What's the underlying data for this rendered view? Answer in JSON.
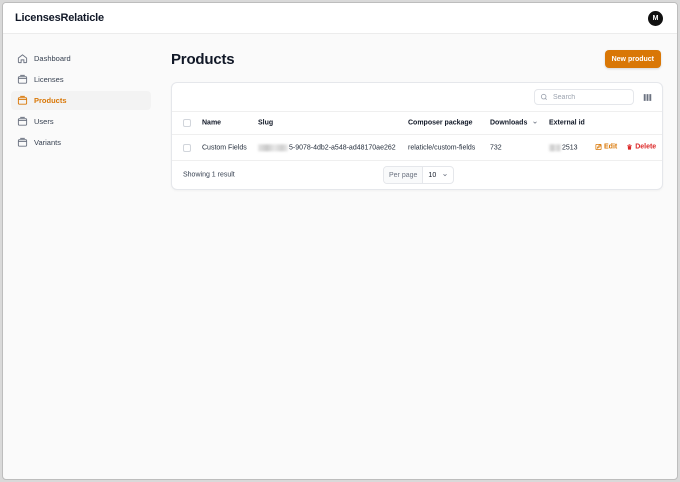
{
  "app": {
    "brand": "LicensesRelaticle",
    "avatar_initial": "M"
  },
  "sidebar": {
    "items": [
      {
        "label": "Dashboard",
        "icon": "home-icon",
        "active": false
      },
      {
        "label": "Licenses",
        "icon": "box-icon",
        "active": false
      },
      {
        "label": "Products",
        "icon": "box-icon",
        "active": true
      },
      {
        "label": "Users",
        "icon": "box-icon",
        "active": false
      },
      {
        "label": "Variants",
        "icon": "box-icon",
        "active": false
      }
    ]
  },
  "page": {
    "title": "Products",
    "new_button": "New product"
  },
  "table": {
    "search_placeholder": "Search",
    "columns": {
      "name": "Name",
      "slug": "Slug",
      "composer": "Composer package",
      "downloads": "Downloads",
      "external_id": "External id"
    },
    "rows": [
      {
        "name": "Custom Fields",
        "slug_visible": "5-9078-4db2-a548-ad48170ae262",
        "composer": "relaticle/custom-fields",
        "downloads": "732",
        "external_id_visible": "2513",
        "edit": "Edit",
        "delete": "Delete"
      }
    ],
    "footer": {
      "summary": "Showing 1 result",
      "per_page_label": "Per page",
      "per_page_value": "10"
    }
  },
  "colors": {
    "accent": "#d97706",
    "danger": "#dc2626"
  }
}
